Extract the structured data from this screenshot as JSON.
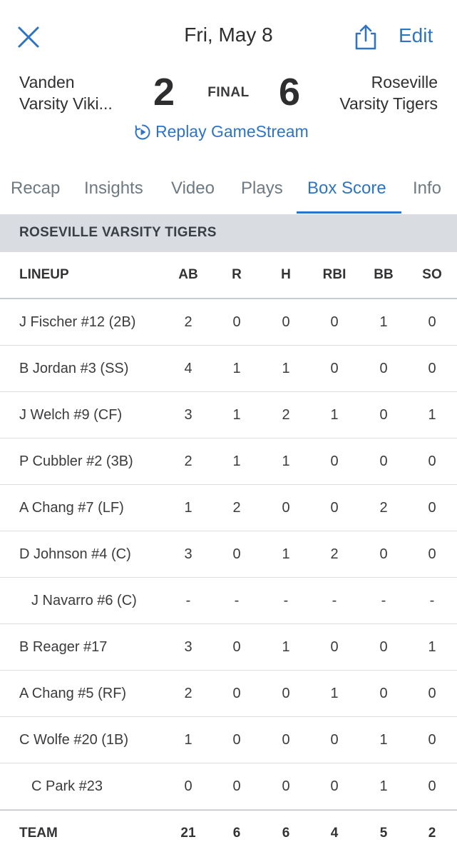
{
  "header": {
    "date": "Fri, May 8",
    "edit_label": "Edit"
  },
  "game": {
    "away_team_line1": "Vanden",
    "away_team_line2": "Varsity Viki...",
    "home_team_line1": "Roseville",
    "home_team_line2": "Varsity Tigers",
    "away_score": "2",
    "home_score": "6",
    "status": "FINAL",
    "replay_label": "Replay GameStream"
  },
  "tabs": [
    "Recap",
    "Insights",
    "Video",
    "Plays",
    "Box Score",
    "Info"
  ],
  "active_tab": "Box Score",
  "box": {
    "team_header": "ROSEVILLE VARSITY TIGERS",
    "columns": [
      "LINEUP",
      "AB",
      "R",
      "H",
      "RBI",
      "BB",
      "SO"
    ],
    "rows": [
      {
        "name": "J Fischer #12 (2B)",
        "sub": false,
        "stats": [
          "2",
          "0",
          "0",
          "0",
          "1",
          "0"
        ]
      },
      {
        "name": "B Jordan #3 (SS)",
        "sub": false,
        "stats": [
          "4",
          "1",
          "1",
          "0",
          "0",
          "0"
        ]
      },
      {
        "name": "J Welch #9 (CF)",
        "sub": false,
        "stats": [
          "3",
          "1",
          "2",
          "1",
          "0",
          "1"
        ]
      },
      {
        "name": "P Cubbler #2 (3B)",
        "sub": false,
        "stats": [
          "2",
          "1",
          "1",
          "0",
          "0",
          "0"
        ]
      },
      {
        "name": "A Chang #7 (LF)",
        "sub": false,
        "stats": [
          "1",
          "2",
          "0",
          "0",
          "2",
          "0"
        ]
      },
      {
        "name": "D Johnson #4 (C)",
        "sub": false,
        "stats": [
          "3",
          "0",
          "1",
          "2",
          "0",
          "0"
        ]
      },
      {
        "name": "J Navarro #6 (C)",
        "sub": true,
        "stats": [
          "-",
          "-",
          "-",
          "-",
          "-",
          "-"
        ]
      },
      {
        "name": "B Reager #17",
        "sub": false,
        "stats": [
          "3",
          "0",
          "1",
          "0",
          "0",
          "1"
        ]
      },
      {
        "name": "A Chang #5 (RF)",
        "sub": false,
        "stats": [
          "2",
          "0",
          "0",
          "1",
          "0",
          "0"
        ]
      },
      {
        "name": "C Wolfe #20 (1B)",
        "sub": false,
        "stats": [
          "1",
          "0",
          "0",
          "0",
          "1",
          "0"
        ]
      },
      {
        "name": "C Park #23",
        "sub": true,
        "stats": [
          "0",
          "0",
          "0",
          "0",
          "1",
          "0"
        ]
      }
    ],
    "total": {
      "name": "TEAM",
      "stats": [
        "21",
        "6",
        "6",
        "4",
        "5",
        "2"
      ]
    }
  },
  "colors": {
    "accent": "#2f74c4",
    "section_bg": "#d9dde2",
    "text": "#2b2b2e",
    "tab_inactive": "#6d7983"
  },
  "icons": {
    "close": "close-icon",
    "share": "share-icon",
    "replay": "replay-icon"
  }
}
